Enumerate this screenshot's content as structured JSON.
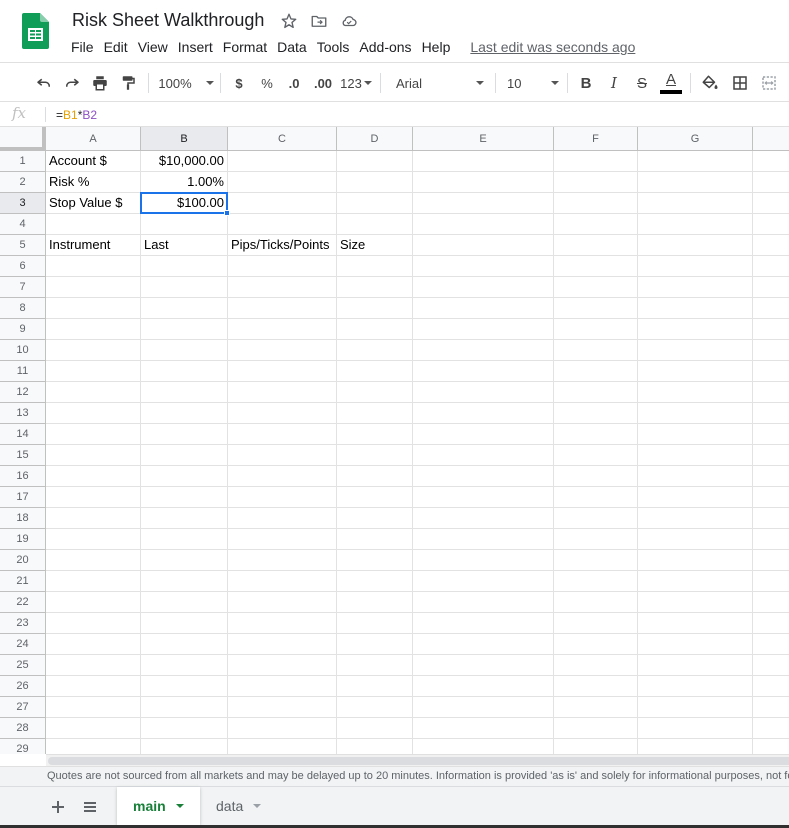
{
  "app": {
    "doc_title": "Risk Sheet Walkthrough",
    "last_edit": "Last edit was seconds ago",
    "menu": [
      "File",
      "Edit",
      "View",
      "Insert",
      "Format",
      "Data",
      "Tools",
      "Add-ons",
      "Help"
    ]
  },
  "toolbar": {
    "zoom": "100%",
    "currency": "$",
    "percent": "%",
    "dec_less": ".0",
    "dec_more": ".00",
    "more_formats": "123",
    "font": "Arial",
    "font_size": "10",
    "bold": "B",
    "italic": "I",
    "strike": "S",
    "text_color": "A"
  },
  "formula_bar": {
    "fx": "fx",
    "eq": "=",
    "ref1": "B1",
    "op": "*",
    "ref2": "B2"
  },
  "grid": {
    "columns": [
      "A",
      "B",
      "C",
      "D",
      "E",
      "F",
      "G"
    ],
    "rows": [
      "1",
      "2",
      "3",
      "4",
      "5",
      "6",
      "7",
      "8",
      "9",
      "10",
      "11",
      "12",
      "13",
      "14",
      "15",
      "16",
      "17",
      "18",
      "19",
      "20",
      "21",
      "22",
      "23",
      "24",
      "25",
      "26",
      "27",
      "28",
      "29"
    ],
    "selected_cell": "B3",
    "cells": {
      "A1": "Account $",
      "B1": "$10,000.00",
      "A2": "Risk %",
      "B2": "1.00%",
      "A3": "Stop Value $",
      "B3": "$100.00",
      "A5": "Instrument",
      "B5": "Last",
      "C5": "Pips/Ticks/Points",
      "D5": "Size"
    }
  },
  "disclaimer": "Quotes are not sourced from all markets and may be delayed up to 20 minutes. Information is provided 'as is' and solely for informational purposes, not for trading purposes or advice.",
  "sheets": [
    {
      "name": "main",
      "active": true
    },
    {
      "name": "data",
      "active": false
    }
  ],
  "colors": {
    "accent": "#1a73e8",
    "sheets_green": "#188038",
    "ref1": "#e7a100",
    "ref2": "#8e4ec6"
  }
}
